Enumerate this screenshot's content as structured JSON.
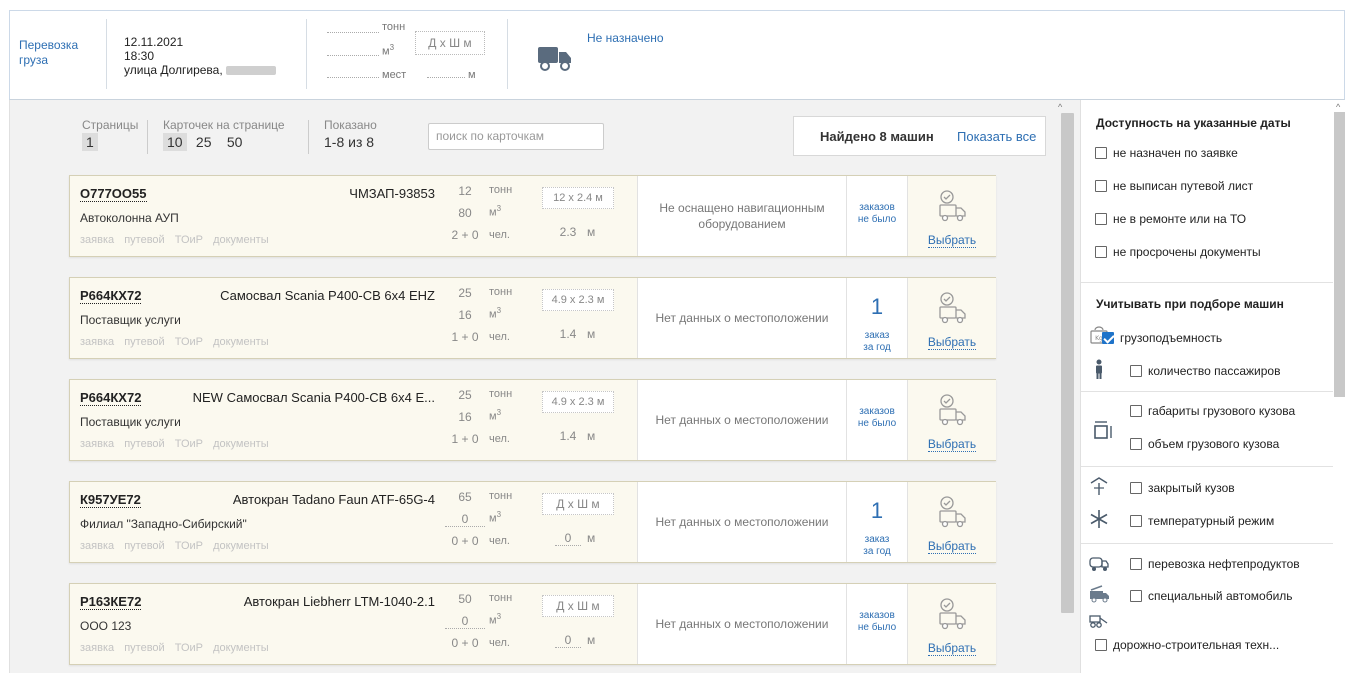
{
  "header": {
    "type_label": "Перевозка груза",
    "date": "12.11.2021",
    "time": "18:30",
    "address": "улица Долгирева,",
    "unit_tons": "тонн",
    "unit_m3_base": "м",
    "unit_m3_sup": "3",
    "unit_places": "мест",
    "dimensions_placeholder": "Д х Ш м",
    "unit_m": "м",
    "status": "Не назначено"
  },
  "toolbar": {
    "pages_label": "Страницы",
    "pages_current": "1",
    "per_page_label": "Карточек на странице",
    "per_page_options": [
      "10",
      "25",
      "50"
    ],
    "shown_label": "Показано",
    "shown_value": "1-8 из 8",
    "search_placeholder": "поиск по карточкам",
    "found_text": "Найдено 8 машин",
    "show_all": "Показать все"
  },
  "card_links": [
    "заявка",
    "путевой",
    "ТОиР",
    "документы"
  ],
  "select_label": "Выбрать",
  "units": {
    "tons": "тонн",
    "m3": "м",
    "m3_sup": "3",
    "people": "чел.",
    "m": "м"
  },
  "cards": [
    {
      "plate": "О777ОО55",
      "model": "ЧМЗАП-93853",
      "owner": "Автоколонна АУП",
      "tons": "12",
      "volume": "80",
      "people": "2 + 0",
      "dims": "12 x 2.4 м",
      "height": "2.3",
      "nav": "Не оснащено навигационным оборудованием",
      "orders_num": "",
      "orders_line1": "заказов",
      "orders_line2": "не было"
    },
    {
      "plate": "Р664КХ72",
      "model": "Самосвал Scania P400-CB 6x4 EHZ",
      "owner": "Поставщик услуги",
      "tons": "25",
      "volume": "16",
      "people": "1 + 0",
      "dims": "4.9 x 2.3 м",
      "height": "1.4",
      "nav": "Нет данных о местоположении",
      "orders_num": "1",
      "orders_line1": "заказ",
      "orders_line2": "за год"
    },
    {
      "plate": "Р664КХ72",
      "model": "NEW Самосвал Scania P400-CB 6x4 E...",
      "owner": "Поставщик услуги",
      "tons": "25",
      "volume": "16",
      "people": "1 + 0",
      "dims": "4.9 x 2.3 м",
      "height": "1.4",
      "nav": "Нет данных о местоположении",
      "orders_num": "",
      "orders_line1": "заказов",
      "orders_line2": "не было"
    },
    {
      "plate": "К957УЕ72",
      "model": "Автокран Tadano Faun ATF-65G-4",
      "owner": "Филиал \"Западно-Сибирский\"",
      "tons": "65",
      "volume": "0",
      "people": "0 + 0",
      "dims": "Д х Ш м",
      "height": "0",
      "nav": "Нет данных о местоположении",
      "orders_num": "1",
      "orders_line1": "заказ",
      "orders_line2": "за год"
    },
    {
      "plate": "Р163КЕ72",
      "model": "Автокран Liebherr LTM-1040-2.1",
      "owner": "ООО 123",
      "tons": "50",
      "volume": "0",
      "people": "0 + 0",
      "dims": "Д х Ш м",
      "height": "0",
      "nav": "Нет данных о местоположении",
      "orders_num": "",
      "orders_line1": "заказов",
      "orders_line2": "не было"
    }
  ],
  "right_panel": {
    "availability_title": "Доступность на указанные даты",
    "availability": [
      {
        "label": "не назначен по заявке",
        "checked": false
      },
      {
        "label": "не выписан путевой лист",
        "checked": false
      },
      {
        "label": "не в ремонте или на ТО",
        "checked": false
      },
      {
        "label": "не просрочены документы",
        "checked": false
      }
    ],
    "consider_title": "Учитывать при подборе машин",
    "consider": [
      {
        "label": "грузоподъемность",
        "checked": true,
        "icon": "weight-icon"
      },
      {
        "label": "количество пассажиров",
        "checked": false,
        "icon": "person-icon"
      },
      {
        "label": "габариты грузового кузова",
        "checked": false,
        "icon": "dimensions-icon"
      },
      {
        "label": "объем грузового кузова",
        "checked": false,
        "icon": ""
      },
      {
        "label": "закрытый кузов",
        "checked": false,
        "icon": "canopy-icon"
      },
      {
        "label": "температурный режим",
        "checked": false,
        "icon": "snowflake-icon"
      },
      {
        "label": "перевозка нефтепродуктов",
        "checked": false,
        "icon": "tanker-icon"
      },
      {
        "label": "специальный автомобиль",
        "checked": false,
        "icon": "special-vehicle-icon"
      },
      {
        "label": "дорожно-строительная техн...",
        "checked": false,
        "icon": "road-machine-icon"
      }
    ]
  },
  "colors": {
    "accent": "#2e6fb3",
    "card_bg": "#fbf9ef",
    "checkbox_on": "#1e73c9"
  }
}
